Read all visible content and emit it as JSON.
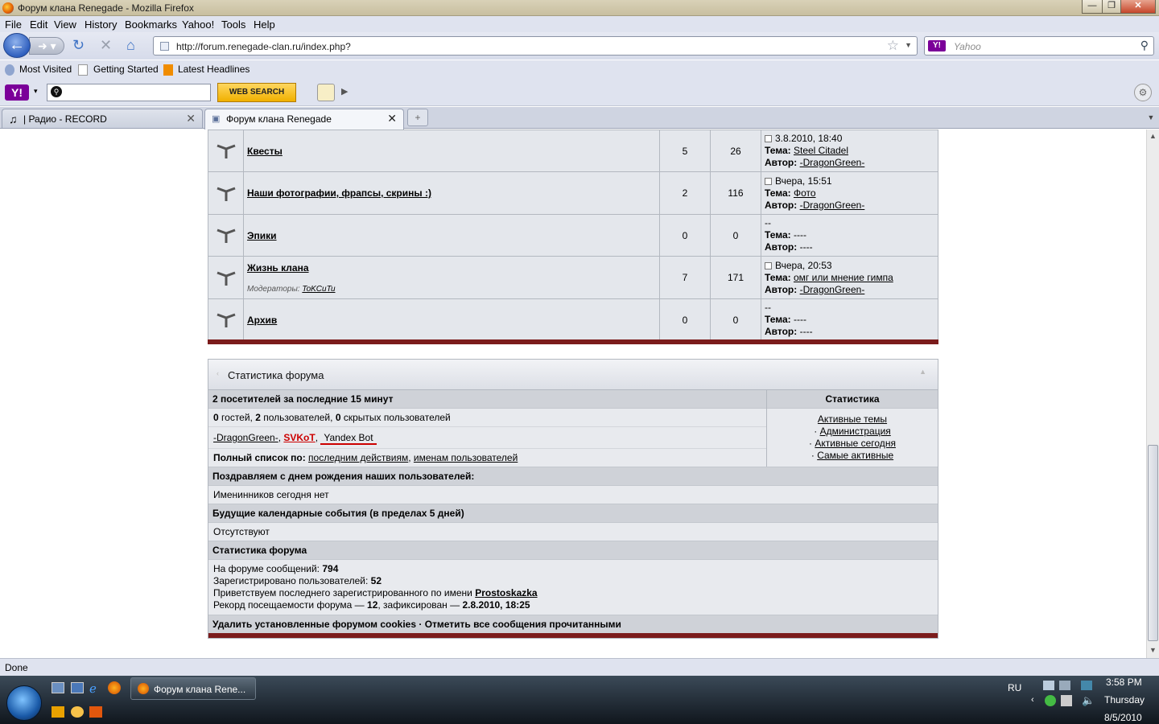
{
  "window": {
    "title": "Форум клана Renegade - Mozilla Firefox"
  },
  "menu": [
    "File",
    "Edit",
    "View",
    "History",
    "Bookmarks",
    "Yahoo!",
    "Tools",
    "Help"
  ],
  "nav": {
    "url": "http://forum.renegade-clan.ru/index.php?",
    "search_placeholder": "Yahoo"
  },
  "bookmarks": [
    "Most Visited",
    "Getting Started",
    "Latest Headlines"
  ],
  "yahoo_toolbar": {
    "web_search": "WEB SEARCH"
  },
  "tabs": [
    {
      "label": "| Радио - RECORD"
    },
    {
      "label": "Форум клана Renegade"
    }
  ],
  "forums": [
    {
      "name": "Квесты",
      "topics": "5",
      "posts": "26",
      "last_date": "3.8.2010, 18:40",
      "last_topic": "Steel Citadel",
      "last_author": "-DragonGreen-"
    },
    {
      "name": "Наши фотографии, фрапсы, скрины :)",
      "topics": "2",
      "posts": "116",
      "last_date": "Вчера, 15:51",
      "last_topic": "Фото",
      "last_author": "-DragonGreen-"
    },
    {
      "name": "Эпики",
      "topics": "0",
      "posts": "0",
      "last_date": "--",
      "last_topic": "----",
      "last_author": "----"
    },
    {
      "name": "Жизнь клана",
      "moderators_label": "Модераторы:",
      "moderator": "ToKCuTu",
      "topics": "7",
      "posts": "171",
      "last_date": "Вчера, 20:53",
      "last_topic": "омг или мнение гимпа",
      "last_author": "-DragonGreen-"
    },
    {
      "name": "Архив",
      "topics": "0",
      "posts": "0",
      "last_date": "--",
      "last_topic": "----",
      "last_author": "----"
    }
  ],
  "labels": {
    "topic": "Тема:",
    "author": "Автор:"
  },
  "stats": {
    "title": "Статистика форума",
    "online_header": "2 посетителей за последние 15 минут",
    "stats_header": "Статистика",
    "guests_n": "0",
    "guests": "гостей,",
    "users_n": "2",
    "users": "пользователей,",
    "hidden_n": "0",
    "hidden": "скрытых пользователей",
    "user1": "-DragonGreen-",
    "user2": "SVKoT",
    "user3": "Yandex Bot",
    "full_list": "Полный список по:",
    "by_last": "последним действиям",
    "by_name": "именам пользователей",
    "links": [
      "Активные темы",
      "Администрация",
      "Активные сегодня",
      "Самые активные"
    ],
    "birthday_header": "Поздравляем с днем рождения наших пользователей:",
    "birthday_text": "Именинников сегодня нет",
    "events_header": "Будущие календарные события (в пределах 5 дней)",
    "events_text": "Отсутствуют",
    "forum_stats_header": "Статистика форума",
    "posts_label": "На форуме сообщений:",
    "posts_value": "794",
    "reg_label": "Зарегистрировано пользователей:",
    "reg_value": "52",
    "welcome_label": "Приветствуем последнего зарегистрированного по имени",
    "welcome_user": "Prostoskazka",
    "record_label": "Рекорд посещаемости форума —",
    "record_value": "12",
    "record_mid": ", зафиксирован —",
    "record_date": "2.8.2010, 18:25",
    "footer": "Удалить установленные форумом cookies · Отметить все сообщения прочитанными"
  },
  "status": {
    "text": "Done"
  },
  "taskbar": {
    "app": "Форум клана Rene...",
    "lang": "RU",
    "time": "3:58 PM",
    "day": "Thursday",
    "date": "8/5/2010"
  }
}
